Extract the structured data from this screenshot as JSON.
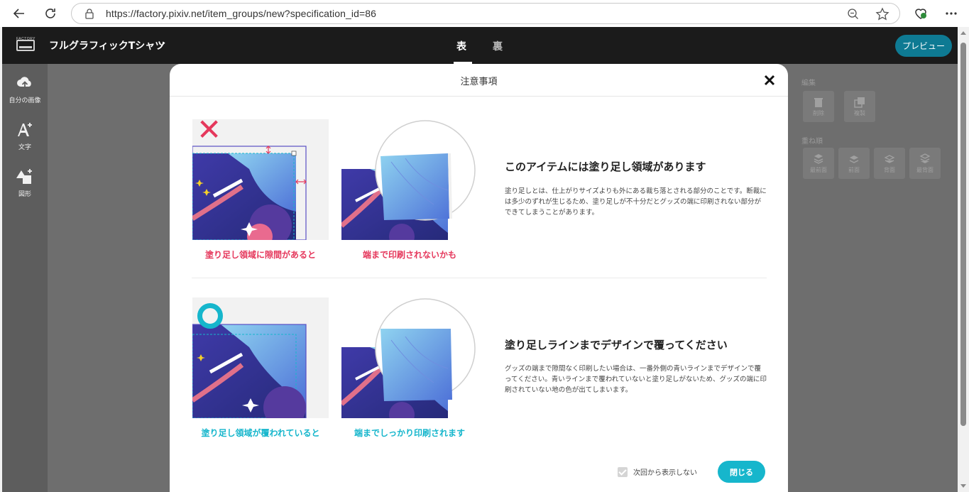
{
  "browser": {
    "url": "https://factory.pixiv.net/item_groups/new?specification_id=86"
  },
  "app": {
    "logo_text": "FACTORY",
    "product_title": "フルグラフィックTシャツ",
    "tabs": [
      {
        "label": "表",
        "active": true
      },
      {
        "label": "裏",
        "active": false
      }
    ],
    "preview_label": "プレビュー",
    "left_tools": [
      {
        "label": "自分の画像",
        "icon": "cloud-upload-icon"
      },
      {
        "label": "文字",
        "icon": "text-add-icon"
      },
      {
        "label": "図形",
        "icon": "shapes-icon"
      }
    ],
    "right_panel": {
      "edit_heading": "編集",
      "edit_buttons": [
        {
          "label": "削除",
          "icon": "trash-icon"
        },
        {
          "label": "複製",
          "icon": "duplicate-icon"
        }
      ],
      "layer_heading": "重ね順",
      "layer_buttons": [
        {
          "label": "最前面",
          "icon": "bring-to-front-icon"
        },
        {
          "label": "前面",
          "icon": "bring-forward-icon"
        },
        {
          "label": "背面",
          "icon": "send-backward-icon"
        },
        {
          "label": "最背面",
          "icon": "send-to-back-icon"
        }
      ]
    }
  },
  "modal": {
    "title": "注意事項",
    "sections": [
      {
        "heading": "このアイテムには塗り足し領域があります",
        "body": "塗り足しとは、仕上がりサイズよりも外にある裁ち落とされる部分のことです。断裁には多少のずれが生じるため、塗り足しが不十分だとグッズの端に印刷されない部分ができてしまうことがあります。",
        "caption_left": "塗り足し領域に隙間があると",
        "caption_right": "端まで印刷されないかも",
        "mark": "✕",
        "mark_color": "#e5385c"
      },
      {
        "heading": "塗り足しラインまでデザインで覆ってください",
        "body": "グッズの端まで隙間なく印刷したい場合は、一番外側の青いラインまでデザインで覆ってください。青いラインまで覆われていないと塗り足しがないため、グッズの端に印刷されていない地の色が出てしまいます。",
        "caption_left": "塗り足し領域が覆われていると",
        "caption_right": "端までしっかり印刷されます",
        "mark": "○",
        "mark_color": "#16b6cc"
      }
    ],
    "dont_show_label": "次回から表示しない",
    "dont_show_checked": true,
    "close_label": "閉じる"
  },
  "colors": {
    "accent": "#16b6cc",
    "warning": "#e5385c",
    "preview_button": "#0e7a93"
  }
}
